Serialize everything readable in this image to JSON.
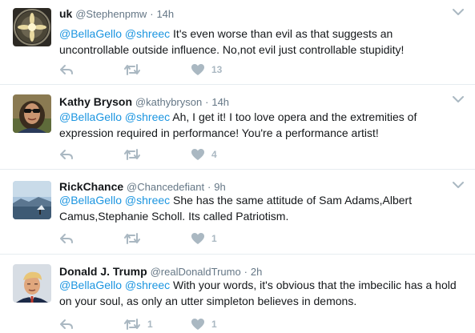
{
  "tweets": [
    {
      "fullname": "uk",
      "username": "@Stephenpmw",
      "dot": "·",
      "time": "14h",
      "mentions": "@BellaGello @shreec",
      "body": " It's even worse than evil as that suggests an uncontrollable outside influence. No,not evil just controllable stupidity!",
      "retweets": "",
      "likes": "13",
      "avatar_icon": "flower-avatar"
    },
    {
      "fullname": "Kathy Bryson",
      "username": "@kathybryson",
      "dot": "·",
      "time": "14h",
      "mentions": "@BellaGello @shreec",
      "body": " Ah, I get it! I too love opera and the extremities of expression required in performance! You're a performance artist!",
      "retweets": "",
      "likes": "4",
      "avatar_icon": "woman-sunglasses-avatar"
    },
    {
      "fullname": "RickChance",
      "username": "@Chancedefiant",
      "dot": "·",
      "time": "9h",
      "mentions": "@BellaGello @shreec",
      "body": " She has the same attitude of Sam Adams,Albert Camus,Stephanie Scholl. Its called Patriotism.",
      "retweets": "",
      "likes": "1",
      "avatar_icon": "landscape-avatar"
    },
    {
      "fullname": "Donald J. Trump",
      "username": "@realDonaldTrumo",
      "dot": "·",
      "time": "2h",
      "mentions": "@BellaGello @shreec",
      "body": " With your words, it's obvious that the imbecilic has a hold on your soul, as only an utter simpleton believes in demons.",
      "retweets": "1",
      "likes": "1",
      "avatar_icon": "man-portrait-avatar"
    }
  ],
  "colors": {
    "link": "#1b95e0",
    "secondary_text": "#657786",
    "icon": "#aab8c2",
    "divider": "#e6ecf0"
  }
}
